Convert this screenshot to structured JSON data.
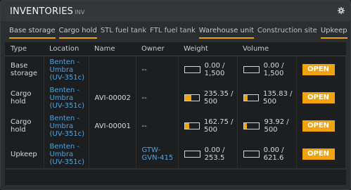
{
  "header": {
    "title": "INVENTORIES",
    "command": "INV",
    "settings_icon": "gear-icon"
  },
  "tabs": [
    {
      "label": "Base storage",
      "active": true
    },
    {
      "label": "Cargo hold",
      "active": true
    },
    {
      "label": "STL fuel tank",
      "active": false
    },
    {
      "label": "FTL fuel tank",
      "active": false
    },
    {
      "label": "Warehouse unit",
      "active": true
    },
    {
      "label": "Construction site",
      "active": false
    },
    {
      "label": "Upkeep",
      "active": true
    }
  ],
  "columns": [
    "Type",
    "Location",
    "Name",
    "Owner",
    "Weight",
    "Volume",
    ""
  ],
  "rows": [
    {
      "type": "Base storage",
      "location": "Benten - Umbra (UV-351c)",
      "name": "",
      "owner": "--",
      "weight": "0.00 / 1,500",
      "weight_fill": 0.0,
      "volume": "0.00 / 1,500",
      "volume_fill": 0.0,
      "action": "OPEN"
    },
    {
      "type": "Cargo hold",
      "location": "Benten - Umbra (UV-351c)",
      "name": "AVI-00002",
      "owner": "--",
      "weight": "235.35 / 500",
      "weight_fill": 0.47,
      "volume": "135.83 / 500",
      "volume_fill": 0.27,
      "action": "OPEN"
    },
    {
      "type": "Cargo hold",
      "location": "Benten - Umbra (UV-351c)",
      "name": "AVI-00001",
      "owner": "--",
      "weight": "162.75 / 500",
      "weight_fill": 0.33,
      "volume": "93.92 / 500",
      "volume_fill": 0.19,
      "action": "OPEN"
    },
    {
      "type": "Upkeep",
      "location": "Benten - Umbra (UV-351c)",
      "name": "",
      "owner": "GTW-GVN-415",
      "weight": "0.00 / 253.5",
      "weight_fill": 0.0,
      "volume": "0.00 / 621.6",
      "volume_fill": 0.0,
      "action": "OPEN"
    }
  ],
  "colors": {
    "accent": "#f0a30a",
    "link": "#4ea3de",
    "panel": "#2b2e31"
  }
}
